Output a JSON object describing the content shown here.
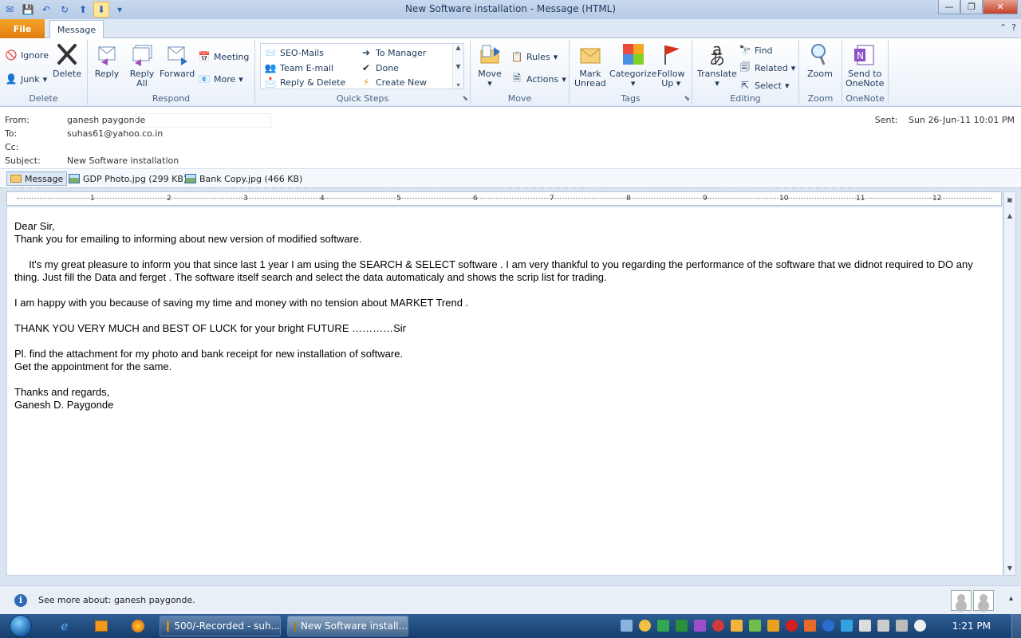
{
  "window": {
    "title": "New Software installation  -  Message (HTML)"
  },
  "tabs": {
    "file": "File",
    "message": "Message"
  },
  "ribbon": {
    "delete_group": {
      "label": "Delete",
      "ignore": "Ignore",
      "junk": "Junk",
      "delete": "Delete"
    },
    "respond_group": {
      "label": "Respond",
      "reply": "Reply",
      "reply_all_1": "Reply",
      "reply_all_2": "All",
      "forward": "Forward",
      "meeting": "Meeting",
      "more": "More"
    },
    "quicksteps_group": {
      "label": "Quick Steps",
      "items": [
        "SEO-Mails",
        "To Manager",
        "Team E-mail",
        "Done",
        "Reply & Delete",
        "Create New"
      ]
    },
    "move_group": {
      "label": "Move",
      "move": "Move",
      "rules": "Rules",
      "actions": "Actions"
    },
    "tags_group": {
      "label": "Tags",
      "mark_unread_1": "Mark",
      "mark_unread_2": "Unread",
      "categorize": "Categorize",
      "follow_up_1": "Follow",
      "follow_up_2": "Up"
    },
    "editing_group": {
      "label": "Editing",
      "translate": "Translate",
      "find": "Find",
      "related": "Related",
      "select": "Select"
    },
    "zoom_group": {
      "label": "Zoom",
      "zoom": "Zoom"
    },
    "onenote_group": {
      "label": "OneNote",
      "send_1": "Send to",
      "send_2": "OneNote"
    }
  },
  "header": {
    "from_label": "From:",
    "from_value": "ganesh paygonde",
    "to_label": "To:",
    "to_value": "suhas61@yahoo.co.in",
    "cc_label": "Cc:",
    "cc_value": "",
    "subject_label": "Subject:",
    "subject_value": "New Software installation",
    "sent_label": "Sent:",
    "sent_value": "Sun 26-Jun-11 10:01 PM"
  },
  "attachments": {
    "message_tab": "Message",
    "files": [
      "GDP Photo.jpg (299 KB)",
      "Bank Copy.jpg (466 KB)"
    ]
  },
  "ruler": {
    "numbers": [
      "1",
      "2",
      "3",
      "4",
      "5",
      "6",
      "7",
      "8",
      "9",
      "10",
      "11",
      "12"
    ]
  },
  "body": {
    "greeting": "Dear Sir,",
    "line1": "Thank you for emailing to informing about new version of modified software.",
    "para2": "     It's my great pleasure to inform you that since last 1 year I am using the SEARCH & SELECT software . I am very thankful to you regarding the performance of the software that we didnot required to DO any thing. Just fill the Data and ferget . The software itself search and select the data automaticaly and shows the scrip list for trading.",
    "para3": "I am happy with you because of saving my time and money with no tension about MARKET Trend .",
    "para4": "THANK YOU VERY MUCH and BEST OF LUCK for your bright FUTURE …………Sir",
    "para5a": "Pl. find the attachment for my photo and bank receipt for new installation of software.",
    "para5b": "Get the appointment for the same.",
    "closing1": "Thanks and regards,",
    "closing2": "Ganesh D. Paygonde"
  },
  "people_pane": {
    "text": "See more about: ganesh paygonde."
  },
  "taskbar": {
    "tasks": [
      "500/-Recorded - suh...",
      "New Software install..."
    ],
    "clock": "1:21 PM"
  }
}
